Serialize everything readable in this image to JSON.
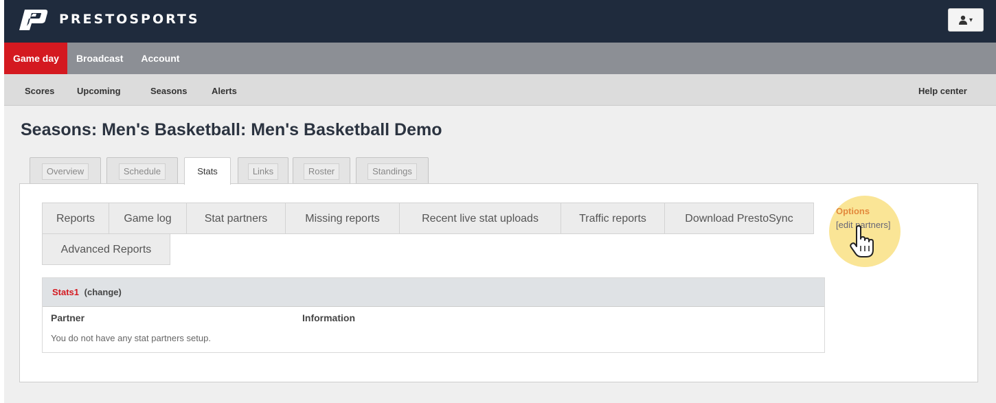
{
  "app": {
    "logo_text": "PRESTOSPORTS"
  },
  "main_nav": [
    {
      "label": "Game day",
      "active": true
    },
    {
      "label": "Broadcast",
      "active": false
    },
    {
      "label": "Account",
      "active": false
    }
  ],
  "sub_nav": {
    "items": [
      "Scores",
      "Upcoming",
      "Seasons",
      "Alerts"
    ],
    "help": "Help center"
  },
  "page": {
    "title": "Seasons: Men's Basketball: Men's Basketball Demo"
  },
  "tabs": [
    {
      "label": "Overview",
      "active": false
    },
    {
      "label": "Schedule",
      "active": false
    },
    {
      "label": "Stats",
      "active": true
    },
    {
      "label": "Links",
      "active": false
    },
    {
      "label": "Roster",
      "active": false
    },
    {
      "label": "Standings",
      "active": false
    }
  ],
  "sub_tabs": [
    "Reports",
    "Game log",
    "Stat partners",
    "Missing reports",
    "Recent live stat uploads",
    "Traffic reports",
    "Download PrestoSync",
    "Advanced Reports"
  ],
  "options": {
    "label": "Options",
    "link": "[edit partners]"
  },
  "stats_table": {
    "name": "Stats1",
    "change": "(change)",
    "columns": [
      "Partner",
      "Information"
    ],
    "empty_message": "You do not have any stat partners setup."
  },
  "colors": {
    "topbar": "#1f2b3d",
    "nav_active": "#d41920",
    "nav_bg": "#8c8f95",
    "options_accent": "#e38a3d"
  },
  "icons": {
    "user_menu": "user-icon",
    "cursor": "hand-pointer-icon"
  }
}
